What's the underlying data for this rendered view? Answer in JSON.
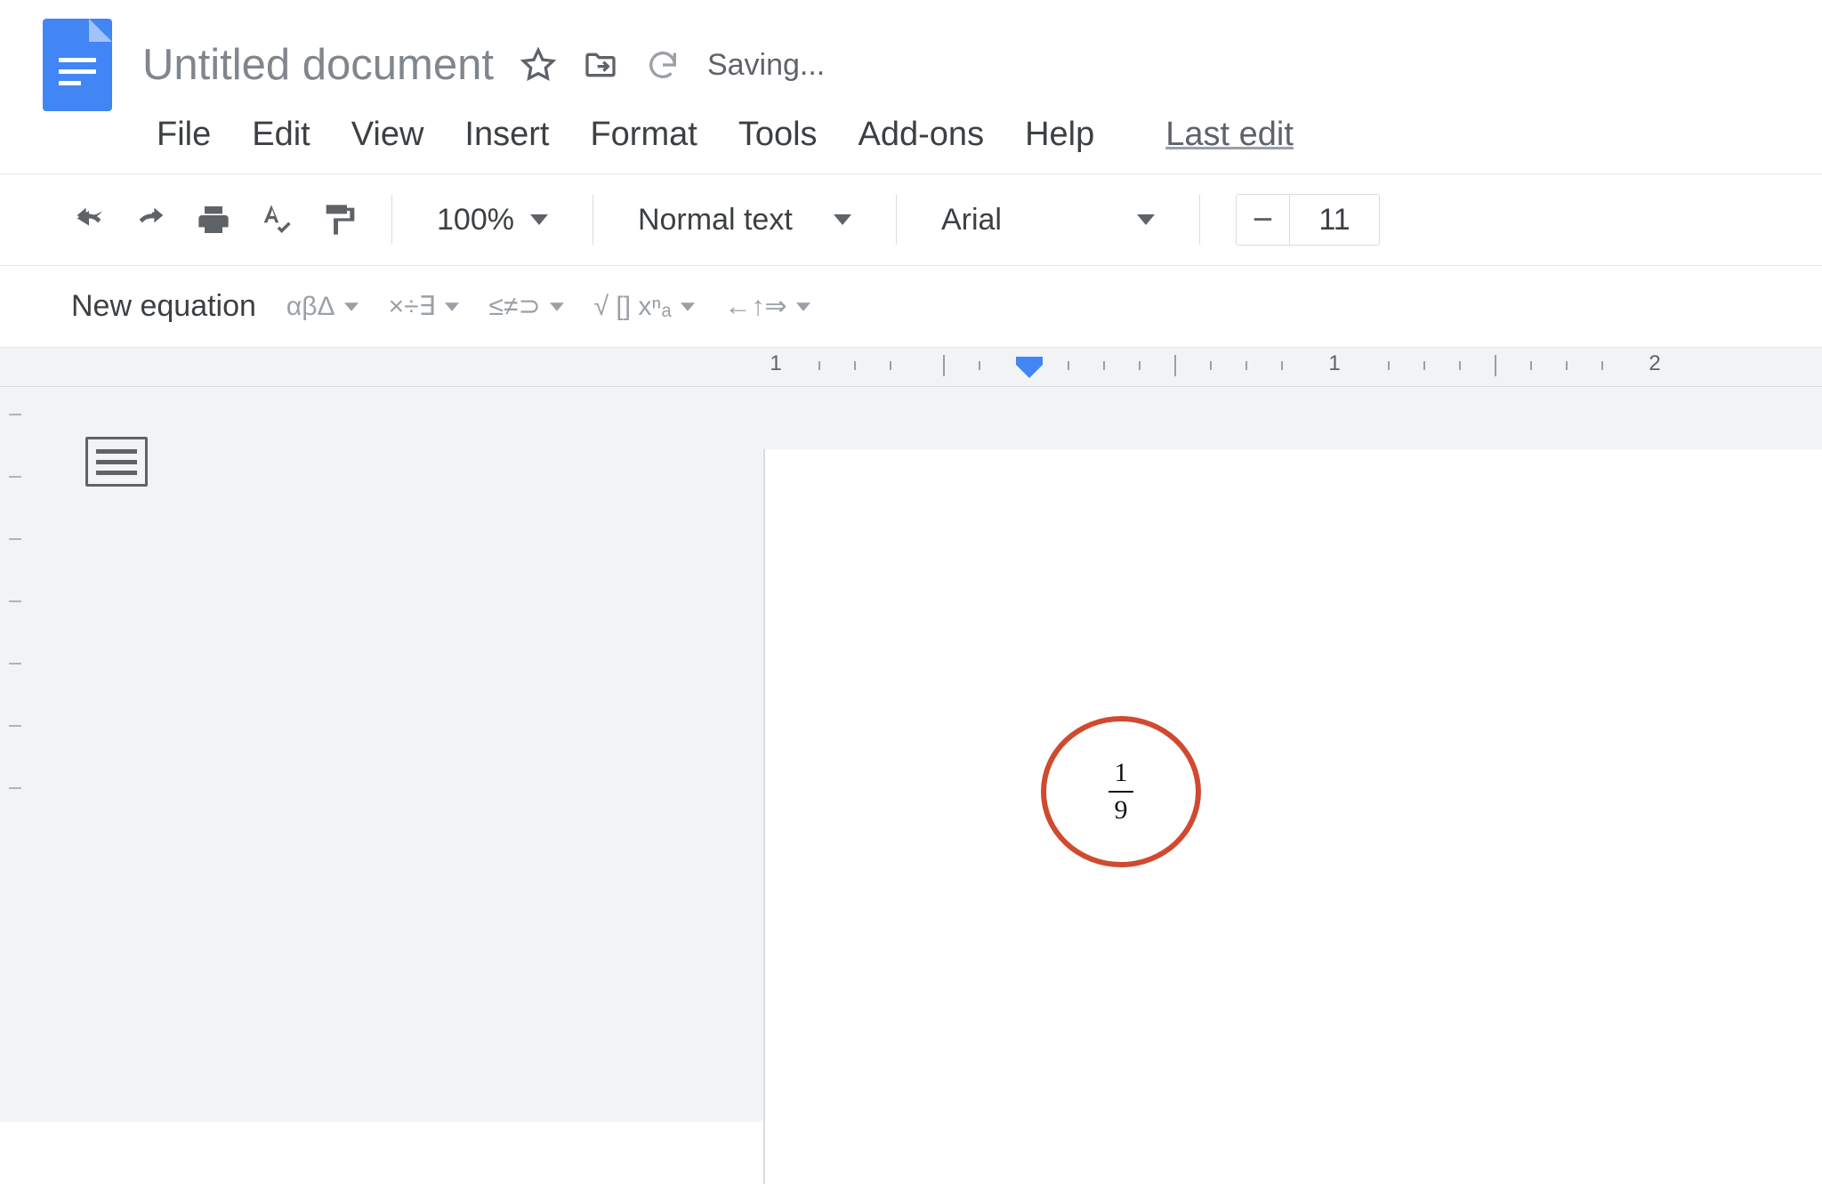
{
  "header": {
    "title": "Untitled document",
    "saving": "Saving..."
  },
  "menu": {
    "file": "File",
    "edit": "Edit",
    "view": "View",
    "insert": "Insert",
    "format": "Format",
    "tools": "Tools",
    "addons": "Add-ons",
    "help": "Help",
    "last_edit": "Last edit"
  },
  "toolbar": {
    "zoom": "100%",
    "style": "Normal text",
    "font": "Arial",
    "font_size": "11",
    "minus": "−"
  },
  "equation": {
    "new": "New equation",
    "greek": "αβΔ",
    "ops": "×÷∃",
    "rel": "≤≠⊃",
    "misc": "√ [] xⁿₐ",
    "arrows": "←↑⇒"
  },
  "ruler": {
    "n1": "1",
    "n2": "2"
  },
  "page": {
    "fraction_top": "1",
    "fraction_bottom": "9"
  }
}
